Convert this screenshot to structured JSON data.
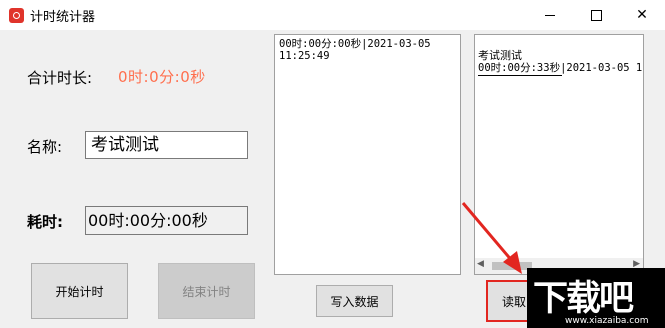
{
  "window": {
    "title": "计时统计器",
    "minimize": "—",
    "close": "✕"
  },
  "main": {
    "total_label": "合计时长:",
    "total_value": "0时:0分:0秒",
    "name_label": "名称:",
    "name_value": "考试测试",
    "elapsed_label": "耗时:",
    "elapsed_value": "00时:00分:00秒",
    "start_button": "开始计时",
    "stop_button": "结束计时",
    "write_button": "写入数据",
    "read_button": "读取",
    "log_text": "00时:00分:00秒|2021-03-05\n11:25:49",
    "list": {
      "item_name": "考试测试",
      "item_line": "00时:00分:33秒|2021-03-05 1"
    }
  },
  "watermark": {
    "brand": "下载吧",
    "url": "www.xiazaiba.com"
  },
  "colors": {
    "total_value": "#ff6f4e",
    "highlight": "#e22620"
  }
}
